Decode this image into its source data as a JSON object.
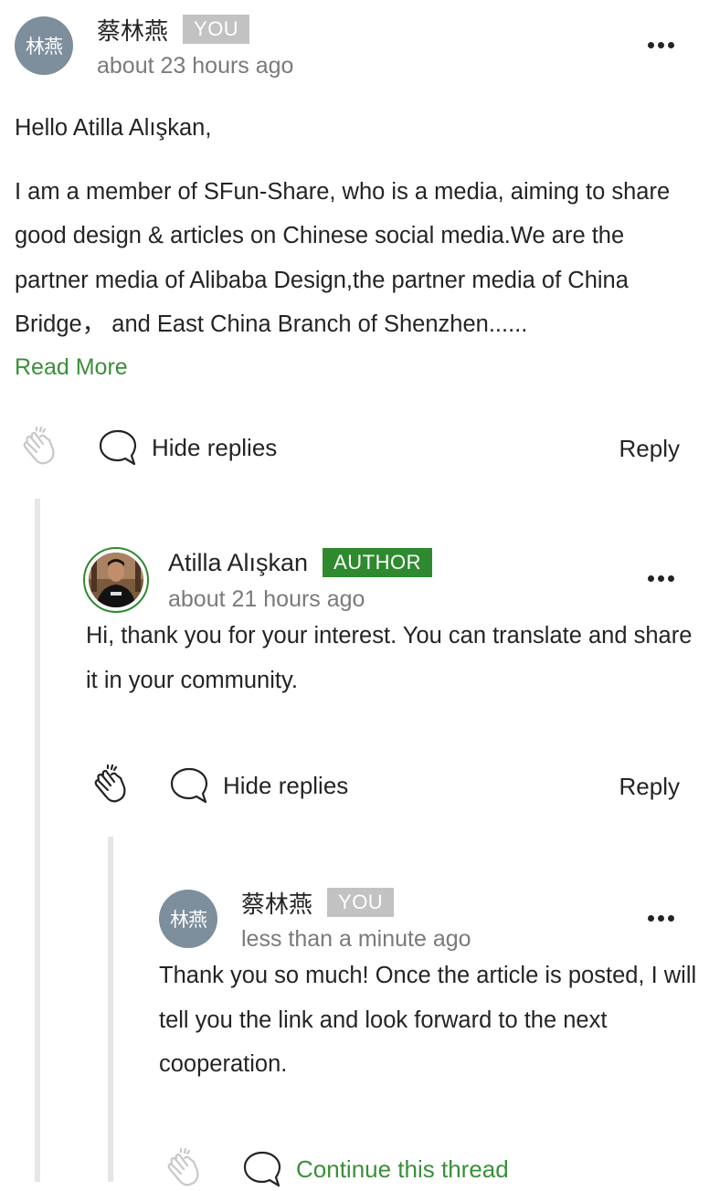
{
  "comments": [
    {
      "avatar_text": "林燕",
      "name": "蔡林燕",
      "badge": "YOU",
      "time": "about 23 hours ago",
      "paragraphs": [
        "Hello Atilla Alışkan,",
        "I am a member of SFun-Share, who is a media, aiming to share good design & articles on Chinese social media.We are the partner media of Alibaba Design,the partner media of China Bridge， and East China Branch of Shenzhen......"
      ],
      "read_more": "Read More",
      "responses_label": "Hide replies",
      "reply_label": "Reply"
    },
    {
      "name": "Atilla Alışkan",
      "badge": "AUTHOR",
      "time": "about 21 hours ago",
      "paragraphs": [
        "Hi, thank you for your interest. You can translate and share it in your community."
      ],
      "responses_label": "Hide replies",
      "reply_label": "Reply"
    },
    {
      "avatar_text": "林燕",
      "name": "蔡林燕",
      "badge": "YOU",
      "time": "less than a minute ago",
      "paragraphs": [
        "Thank you so much! Once the article is posted, I will tell you the link and look forward to the next cooperation."
      ],
      "responses_label": "Continue this thread"
    }
  ],
  "colors": {
    "author_badge": "#2f8a2f",
    "you_badge": "#c2c2c2",
    "link_green": "#3a8f3a",
    "avatar_bg": "#7d8e9c"
  },
  "icons": [
    "clap-icon",
    "response-bubble-icon",
    "more-options-icon"
  ]
}
